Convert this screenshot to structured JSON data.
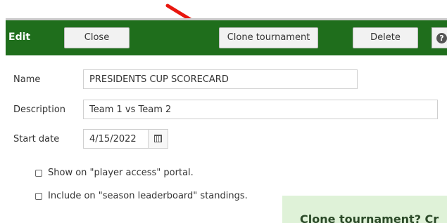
{
  "toolbar": {
    "title": "Edit",
    "close_label": "Close",
    "clone_label": "Clone tournament",
    "delete_label": "Delete",
    "help_symbol": "?",
    "background_color": "#1f6e1c"
  },
  "form": {
    "name_label": "Name",
    "name_value": "PRESIDENTS CUP SCORECARD",
    "description_label": "Description",
    "description_value": "Team 1 vs Team 2",
    "start_date_label": "Start date",
    "start_date_value": "4/15/2022",
    "calendar_icon": "calendar-icon"
  },
  "options": {
    "portal_label": "Show on \"player access\" portal.",
    "leaderboard_label": "Include on \"season leaderboard\" standings."
  },
  "confirm": {
    "text": "Clone tournament? Cr"
  },
  "annotation": {
    "arrow_icon": "red-arrow-icon",
    "arrow_color": "#e8170f"
  }
}
